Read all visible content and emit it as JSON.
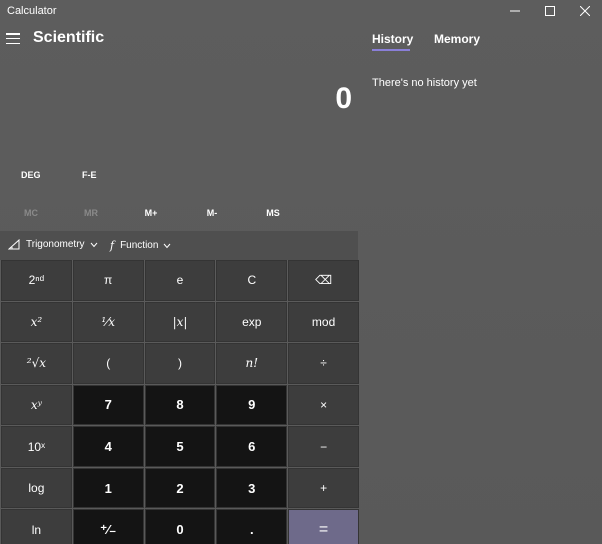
{
  "window": {
    "title": "Calculator",
    "minimize_icon": "minimize-icon",
    "maximize_icon": "maximize-icon",
    "close_icon": "close-icon"
  },
  "header": {
    "menu_icon": "hamburger-icon",
    "mode_title": "Scientific"
  },
  "side_panel": {
    "tabs": [
      {
        "label": "History"
      },
      {
        "label": "Memory"
      }
    ],
    "active_tab": "History",
    "empty_message": "There's no history yet"
  },
  "display": {
    "value": "0"
  },
  "mode_row": {
    "deg_label": "DEG",
    "fe_label": "F-E"
  },
  "memory_row": {
    "items": [
      {
        "label": "MC",
        "enabled": false
      },
      {
        "label": "MR",
        "enabled": false
      },
      {
        "label": "M+",
        "enabled": true
      },
      {
        "label": "M-",
        "enabled": true
      },
      {
        "label": "MS",
        "enabled": true
      }
    ]
  },
  "function_row": {
    "trig_icon": "triangle-ruler-icon",
    "trig_label": "Trigonometry",
    "function_icon": "function-f-icon",
    "function_label": "Function",
    "chevron_icon": "chevron-down-icon"
  },
  "keypad": {
    "keys": [
      [
        "2ⁿᵈ",
        "π",
        "e",
        "C",
        "⌫"
      ],
      [
        "x²",
        "¹⁄x",
        "|x|",
        "exp",
        "mod"
      ],
      [
        "²√x",
        "(",
        ")",
        "n!",
        "÷"
      ],
      [
        "xʸ",
        "7",
        "8",
        "9",
        "×"
      ],
      [
        "10ˣ",
        "4",
        "5",
        "6",
        "−"
      ],
      [
        "log",
        "1",
        "2",
        "3",
        "+"
      ],
      [
        "ln",
        "⁺⁄₋",
        "0",
        ".",
        "="
      ]
    ]
  },
  "colors": {
    "background": "#5c5c5c",
    "number_key": "#141414",
    "function_key": "#3d3d3d",
    "equals_key": "#6e6a8a",
    "accent_underline": "#8a7fd8"
  }
}
